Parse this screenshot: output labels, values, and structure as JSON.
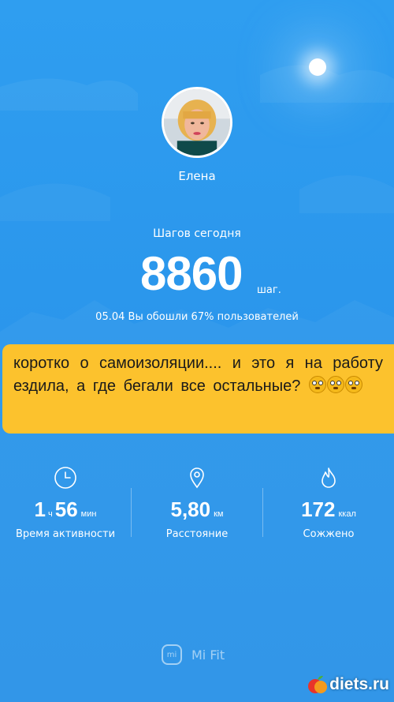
{
  "profile": {
    "name": "Елена"
  },
  "steps": {
    "label": "Шагов сегодня",
    "value": "8860",
    "unit": "шаг.",
    "rank_text": "05.04 Вы обошли 67% пользователей"
  },
  "caption": {
    "text": "коротко о самоизоляции.... и это я на работу ездила, а где бегали все остальные?",
    "emoji": [
      "flushed-face-emoji",
      "flushed-face-emoji",
      "flushed-face-emoji"
    ]
  },
  "stats": {
    "activity": {
      "hours": "1",
      "hours_unit": "ч",
      "minutes": "56",
      "minutes_unit": "мин",
      "label": "Время активности",
      "icon": "clock-icon"
    },
    "distance": {
      "value": "5,80",
      "unit": "км",
      "label": "Расстояние",
      "icon": "location-pin-icon"
    },
    "calories": {
      "value": "172",
      "unit": "ккал",
      "label": "Сожжено",
      "icon": "flame-icon"
    }
  },
  "brand": {
    "logo_text": "mi",
    "name": "Mi Fit"
  },
  "watermark": {
    "text": "diets.ru"
  },
  "colors": {
    "background": "#2b97ec",
    "caption_background": "#fcc22d",
    "text": "#ffffff"
  }
}
